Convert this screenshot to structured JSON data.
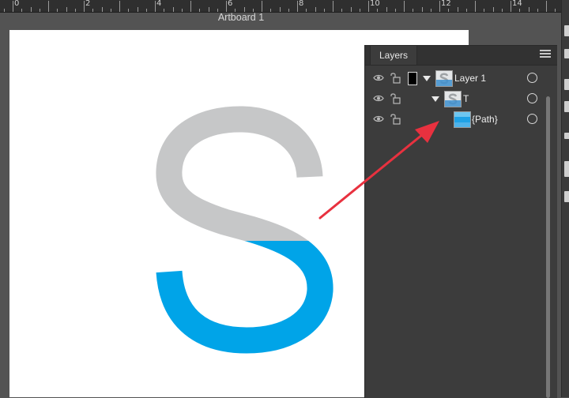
{
  "ruler": {
    "labels": [
      "0",
      "2",
      "4",
      "6",
      "8",
      "10",
      "12",
      "14"
    ]
  },
  "artboard": {
    "title": "Artboard 1"
  },
  "layers_panel": {
    "tab_label": "Layers",
    "rows": [
      {
        "label": "Layer 1",
        "has_color_swatch": true,
        "expanded": true
      },
      {
        "label": "T",
        "expanded": true
      },
      {
        "label": "{Path}"
      }
    ]
  },
  "colors": {
    "glyph_gray": "#c6c7c8",
    "glyph_blue": "#00a4e8",
    "arrow_red": "#e8313f",
    "canvas_background": "#535353",
    "panel_background": "#3c3c3c"
  },
  "icons": {
    "visibility": "eye-icon",
    "lock": "unlock-icon",
    "menu": "hamburger-icon",
    "target": "target-circle-icon"
  }
}
